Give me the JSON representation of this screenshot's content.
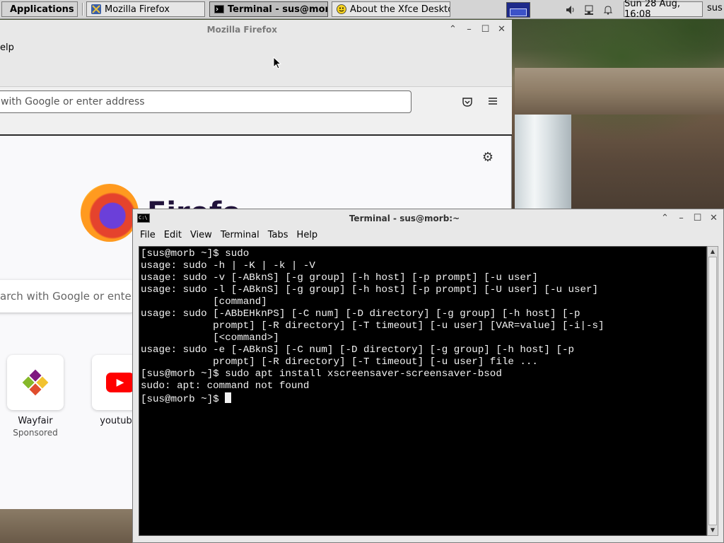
{
  "panel": {
    "applications_label": "Applications",
    "tasks": [
      {
        "label": "Mozilla Firefox"
      },
      {
        "label": "Terminal - sus@mor..."
      },
      {
        "label": "About the Xfce Deskto..."
      }
    ],
    "clock": "Sun 28 Aug, 16:08",
    "user": "sus"
  },
  "firefox": {
    "title": "Mozilla Firefox",
    "menu_help": "elp",
    "urlbar_placeholder": "with Google or enter address",
    "logo_word": "Firefo",
    "search_placeholder": "arch with Google or enter address",
    "tiles": [
      {
        "label": "Wayfair",
        "sublabel": "Sponsored"
      },
      {
        "label": "youtube"
      }
    ]
  },
  "terminal": {
    "title": "Terminal - sus@morb:~",
    "menus": [
      "File",
      "Edit",
      "View",
      "Terminal",
      "Tabs",
      "Help"
    ],
    "lines": [
      "[sus@morb ~]$ sudo",
      "usage: sudo -h | -K | -k | -V",
      "usage: sudo -v [-ABknS] [-g group] [-h host] [-p prompt] [-u user]",
      "usage: sudo -l [-ABknS] [-g group] [-h host] [-p prompt] [-U user] [-u user]",
      "            [command]",
      "usage: sudo [-ABbEHknPS] [-C num] [-D directory] [-g group] [-h host] [-p",
      "            prompt] [-R directory] [-T timeout] [-u user] [VAR=value] [-i|-s]",
      "            [<command>]",
      "usage: sudo -e [-ABknS] [-C num] [-D directory] [-g group] [-h host] [-p",
      "            prompt] [-R directory] [-T timeout] [-u user] file ...",
      "[sus@morb ~]$ sudo apt install xscreensaver-screensaver-bsod",
      "sudo: apt: command not found"
    ],
    "prompt": "[sus@morb ~]$ "
  }
}
